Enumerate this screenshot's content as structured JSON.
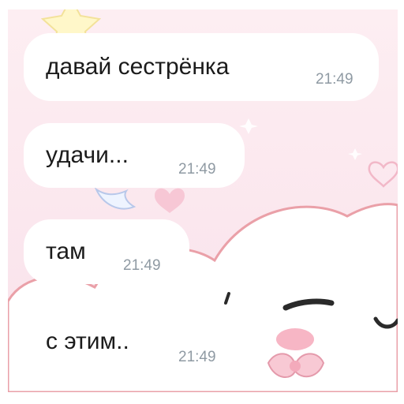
{
  "messages": [
    {
      "text": "давай сестрёнка",
      "time": "21:49"
    },
    {
      "text": "удачи...",
      "time": "21:49"
    },
    {
      "text": "там",
      "time": "21:49"
    },
    {
      "text": "с этим..",
      "time": "21:49"
    }
  ],
  "colors": {
    "bubble": "#ffffff",
    "message_text": "#1b1b1b",
    "timestamp": "#8f9aa3",
    "wallpaper": "#fbe7ee",
    "blush": "#f7b6c5"
  },
  "wallpaper_icons": [
    "star-icon",
    "heart-icon",
    "cloud-character-icon",
    "bow-icon"
  ]
}
